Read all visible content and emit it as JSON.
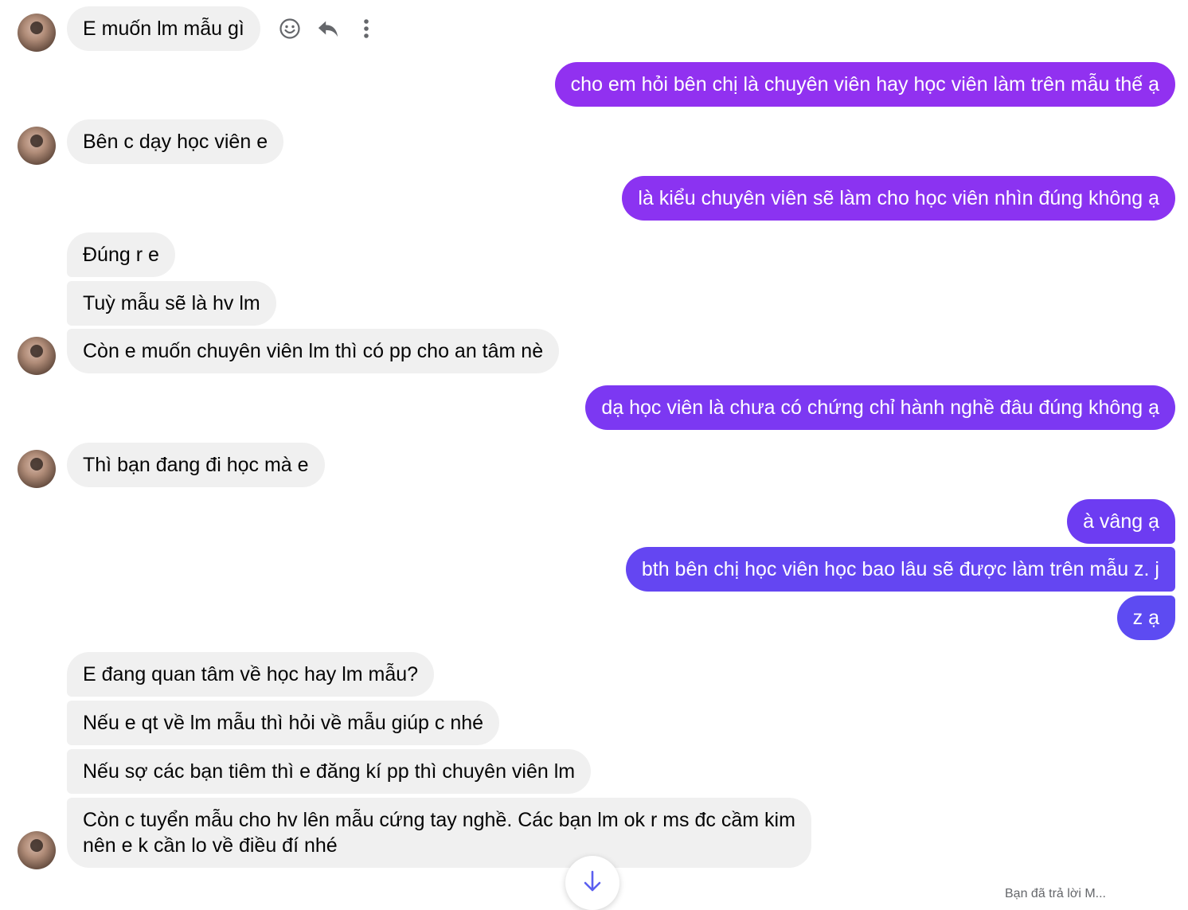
{
  "conversation": {
    "messages": [
      {
        "id": "m1",
        "text": "E muốn lm mẫu gì"
      },
      {
        "id": "m2",
        "text": "cho em hỏi bên chị là chuyên viên hay học viên làm trên mẫu thế ạ"
      },
      {
        "id": "m3",
        "text": "Bên c dạy học viên e"
      },
      {
        "id": "m4",
        "text": "là kiểu chuyên viên sẽ làm cho học viên nhìn đúng không ạ"
      },
      {
        "id": "m5",
        "text": "Đúng r e"
      },
      {
        "id": "m6",
        "text": "Tuỳ mẫu sẽ là hv lm"
      },
      {
        "id": "m7",
        "text": "Còn e muốn chuyên viên lm thì có pp cho an tâm nè"
      },
      {
        "id": "m8",
        "text": "dạ học viên là chưa có chứng chỉ hành nghề đâu đúng không ạ"
      },
      {
        "id": "m9",
        "text": "Thì bạn đang đi học mà e"
      },
      {
        "id": "m10",
        "text": "à vâng ạ"
      },
      {
        "id": "m11",
        "text": "bth bên chị học viên học bao lâu sẽ được làm trên mẫu z. j"
      },
      {
        "id": "m12",
        "text": "z ạ"
      },
      {
        "id": "m13",
        "text": "E đang quan tâm về học hay lm mẫu?"
      },
      {
        "id": "m14",
        "text": "Nếu e qt về lm mẫu thì hỏi về mẫu giúp c nhé"
      },
      {
        "id": "m15",
        "text": "Nếu sợ các bạn tiêm thì e đăng kí pp thì chuyên viên lm"
      },
      {
        "id": "m16",
        "text": "Còn c tuyển mẫu cho hv lên mẫu cứng tay nghề. Các bạn lm ok r ms đc cầm kim"
      },
      {
        "id": "m16b",
        "text": "nên e k cần lo về điều đí nhé"
      }
    ],
    "footer_note": "Bạn đã trả lời M..."
  },
  "icons": {
    "react": "smile-icon",
    "reply": "reply-arrow-icon",
    "more": "more-vertical-icon",
    "scroll": "arrow-down-icon"
  },
  "colors": {
    "incoming_bubble": "#f0f0f0",
    "outgoing_top": "#9b2ff0",
    "outgoing_bottom": "#5a4df2",
    "icon": "#65676b",
    "scroll_arrow": "#5b5ff0"
  }
}
